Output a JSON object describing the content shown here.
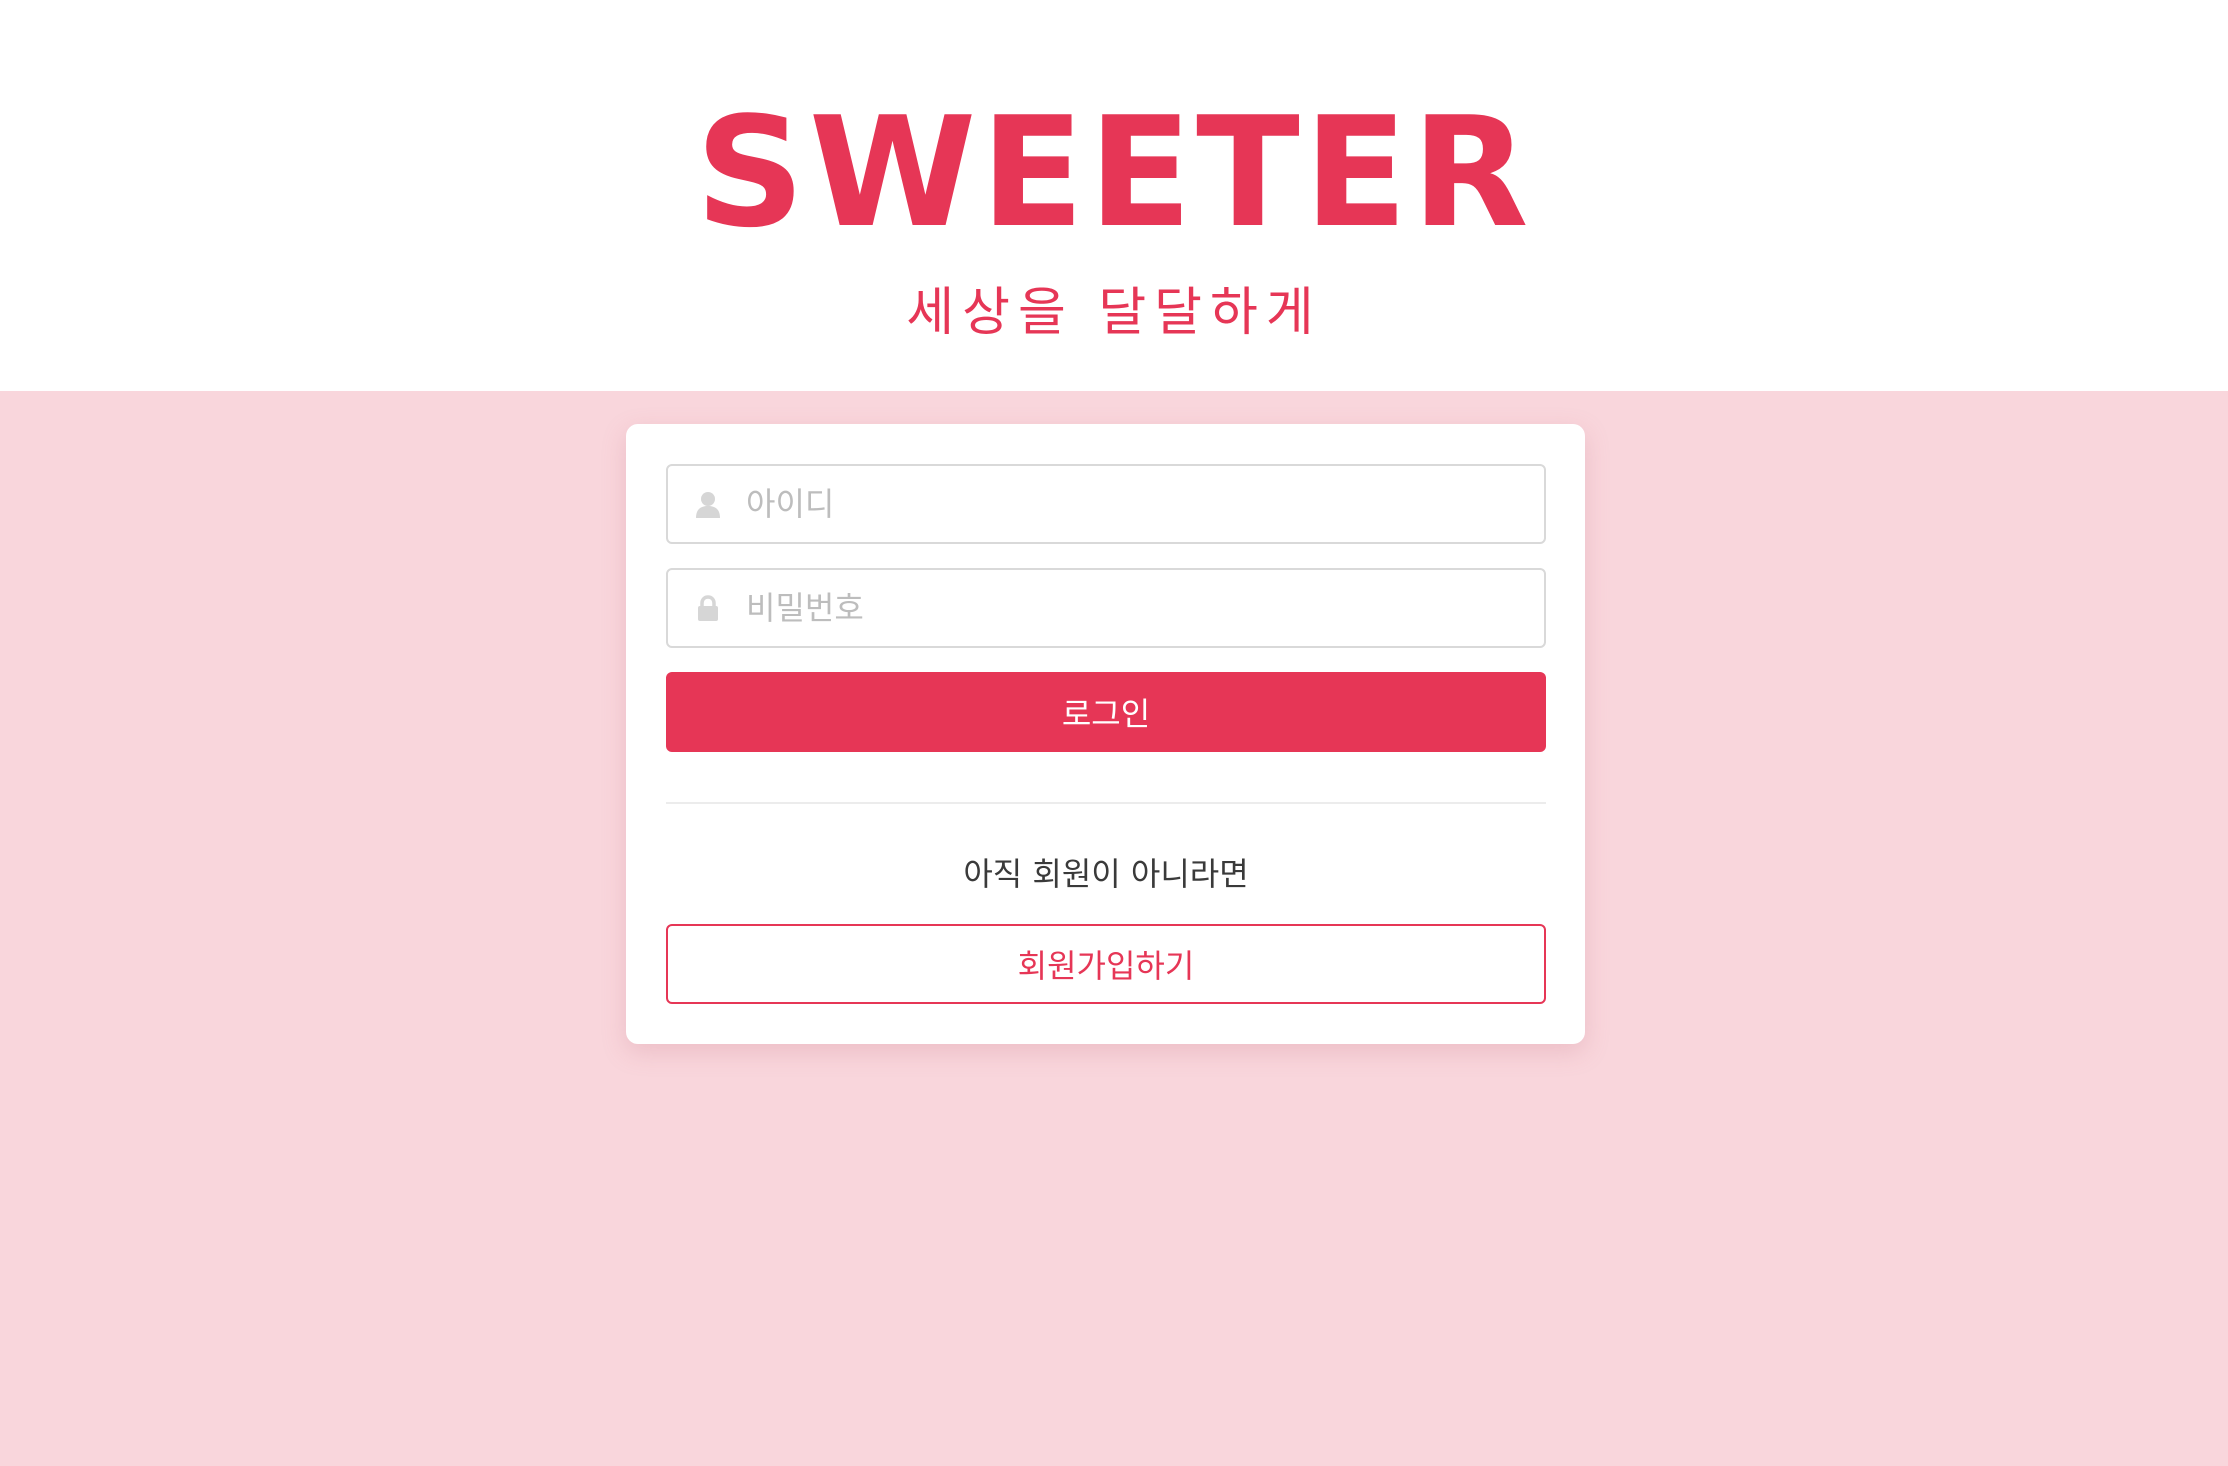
{
  "header": {
    "logo": "SWEETER",
    "tagline": "세상을 달달하게"
  },
  "login_form": {
    "id_placeholder": "아이디",
    "password_placeholder": "비밀번호",
    "login_label": "로그인",
    "signup_prompt": "아직 회원이 아니라면",
    "signup_label": "회원가입하기",
    "icons": {
      "id": "user-icon",
      "password": "lock-icon"
    }
  },
  "colors": {
    "brand": "#e63656",
    "page_background": "#f9d6dc",
    "placeholder": "#bdbdbd"
  }
}
